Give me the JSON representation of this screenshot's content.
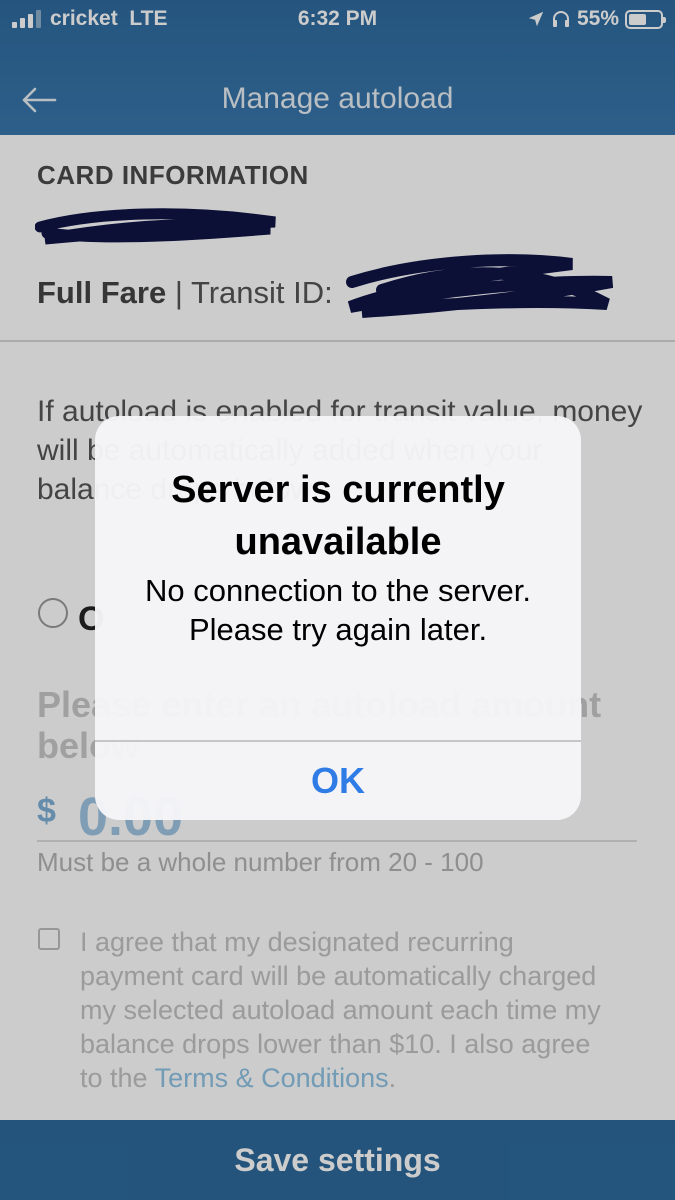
{
  "status_bar": {
    "carrier": "cricket",
    "network": "LTE",
    "time": "6:32 PM",
    "battery": "55%",
    "battery_level": 0.55
  },
  "header": {
    "title": "Manage autoload"
  },
  "card_info": {
    "section_title": "CARD INFORMATION",
    "fare_type": "Full Fare",
    "separator": "|",
    "transit_id_label": "Transit ID:"
  },
  "main": {
    "info_text": "If autoload is enabled for transit value, money will be automatically added when your balance drops below",
    "radio_label": "O",
    "amount_prompt": "Please enter an autoload amount below",
    "currency_symbol": "$",
    "amount_value": "0.00",
    "helper_text": "Must be a whole number from 20 - 100",
    "agreement_text": "I agree that my designated recurring payment card will be automatically charged my selected autoload amount each time my balance drops lower than $10. I also agree to the ",
    "terms_link": "Terms & Conditions",
    "agreement_end": "."
  },
  "footer": {
    "save_label": "Save settings"
  },
  "alert": {
    "title": "Server is currently unavailable",
    "message": "No connection to the server. Please try again later.",
    "ok_label": "OK"
  },
  "colors": {
    "header": "#3877ad",
    "alert_button": "#2f7ce6",
    "save_bar": "#2d6a9b",
    "redaction": "#101545"
  },
  "icons": {
    "back": "arrow-left-icon",
    "location": "location-arrow-icon",
    "headphones": "headphones-icon",
    "battery": "battery-icon",
    "signal": "signal-bars-icon"
  }
}
